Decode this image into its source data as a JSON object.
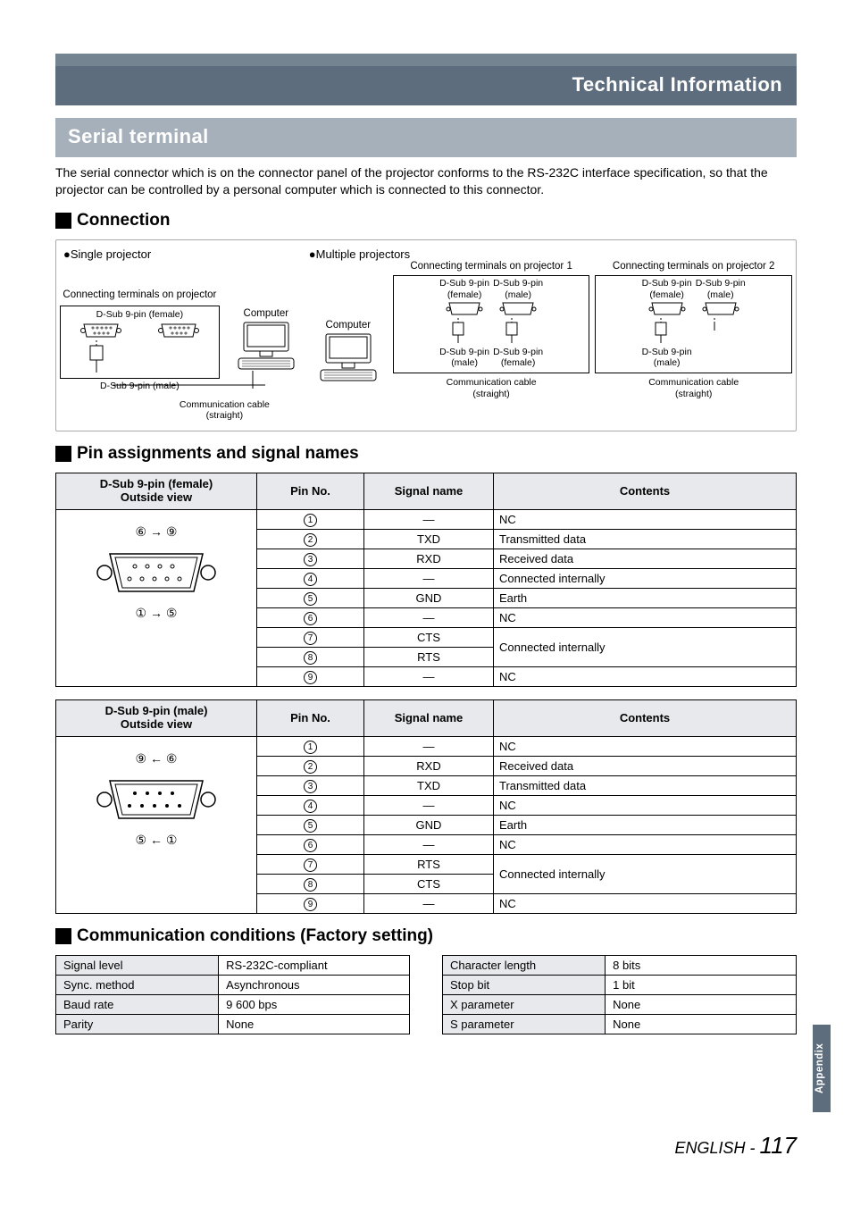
{
  "title_bar": "Technical Information",
  "section_bar": "Serial terminal",
  "intro": "The serial connector which is on the connector panel of the projector conforms to the RS-232C interface specification, so that the projector can be controlled by a personal computer which is connected to this connector.",
  "sub1": "Connection",
  "conn": {
    "single": "●Single projector",
    "multiple": "●Multiple projectors",
    "conn_term_proj": "Connecting terminals on projector",
    "conn_term_proj1": "Connecting terminals on projector 1",
    "conn_term_proj2": "Connecting terminals on projector 2",
    "dsub_f": "D-Sub 9-pin (female)",
    "dsub_m": "D-Sub 9-pin (male)",
    "dsub_f_s": "D-Sub 9-pin\n(female)",
    "dsub_m_s": "D-Sub 9-pin\n(male)",
    "computer": "Computer",
    "cable": "Communication cable (straight)",
    "cable_s": "Communication cable\n(straight)"
  },
  "sub2": "Pin assignments and signal names",
  "table_headers": {
    "view_f": "D-Sub 9-pin (female)\nOutside view",
    "view_m": "D-Sub 9-pin (male)\nOutside view",
    "pin": "Pin No.",
    "sig": "Signal name",
    "cont": "Contents"
  },
  "pin_labels": {
    "f_top": "⑥ → ⑨",
    "f_bot": "① → ⑤",
    "m_top": "⑨ ← ⑥",
    "m_bot": "⑤ ← ①"
  },
  "female_rows": [
    {
      "n": "1",
      "sig": "—",
      "c": "NC"
    },
    {
      "n": "2",
      "sig": "TXD",
      "c": "Transmitted data"
    },
    {
      "n": "3",
      "sig": "RXD",
      "c": "Received data"
    },
    {
      "n": "4",
      "sig": "—",
      "c": "Connected internally"
    },
    {
      "n": "5",
      "sig": "GND",
      "c": "Earth"
    },
    {
      "n": "6",
      "sig": "—",
      "c": "NC"
    },
    {
      "n": "7",
      "sig": "CTS",
      "c": "Connected internally",
      "merge": true
    },
    {
      "n": "8",
      "sig": "RTS",
      "c": ""
    },
    {
      "n": "9",
      "sig": "—",
      "c": "NC"
    }
  ],
  "male_rows": [
    {
      "n": "1",
      "sig": "—",
      "c": "NC"
    },
    {
      "n": "2",
      "sig": "RXD",
      "c": "Received data"
    },
    {
      "n": "3",
      "sig": "TXD",
      "c": "Transmitted data"
    },
    {
      "n": "4",
      "sig": "—",
      "c": "NC"
    },
    {
      "n": "5",
      "sig": "GND",
      "c": "Earth"
    },
    {
      "n": "6",
      "sig": "—",
      "c": "NC"
    },
    {
      "n": "7",
      "sig": "RTS",
      "c": "Connected internally",
      "merge": true
    },
    {
      "n": "8",
      "sig": "CTS",
      "c": ""
    },
    {
      "n": "9",
      "sig": "—",
      "c": "NC"
    }
  ],
  "sub3": "Communication conditions (Factory setting)",
  "comm_left": [
    {
      "k": "Signal level",
      "v": "RS-232C-compliant"
    },
    {
      "k": "Sync. method",
      "v": "Asynchronous"
    },
    {
      "k": "Baud rate",
      "v": "9 600 bps"
    },
    {
      "k": "Parity",
      "v": "None"
    }
  ],
  "comm_right": [
    {
      "k": "Character length",
      "v": "8 bits"
    },
    {
      "k": "Stop bit",
      "v": "1 bit"
    },
    {
      "k": "X parameter",
      "v": "None"
    },
    {
      "k": "S parameter",
      "v": "None"
    }
  ],
  "side_tab": "Appendix",
  "lang": "ENGLISH",
  "dash": " - ",
  "page": "117"
}
